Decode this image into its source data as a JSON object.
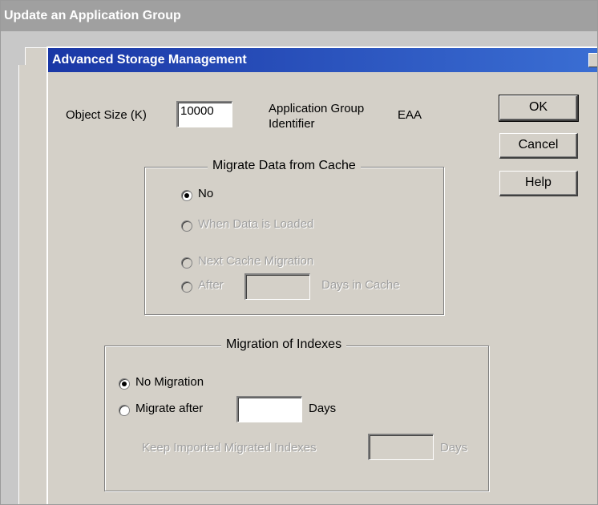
{
  "window": {
    "title": "Update an Application Group"
  },
  "dialog": {
    "title": "Advanced Storage Management"
  },
  "object_size": {
    "label": "Object Size (K)",
    "value": "10000"
  },
  "app_group_identifier": {
    "label_line1": "Application Group",
    "label_line2": "Identifier",
    "value": "EAA"
  },
  "buttons": {
    "ok": "OK",
    "cancel": "Cancel",
    "help": "Help"
  },
  "migrate_cache": {
    "title": "Migrate Data from Cache",
    "options": [
      "No",
      "When Data is Loaded",
      "Next Cache Migration",
      "After"
    ],
    "selected": "No",
    "days_value": "",
    "days_suffix": "Days in Cache"
  },
  "migration_indexes": {
    "title": "Migration of Indexes",
    "options": [
      "No Migration",
      "Migrate after"
    ],
    "selected": "No Migration",
    "migrate_days_value": "",
    "migrate_days_suffix": "Days",
    "keep_label": "Keep Imported Migrated Indexes",
    "keep_value": "",
    "keep_suffix": "Days"
  }
}
